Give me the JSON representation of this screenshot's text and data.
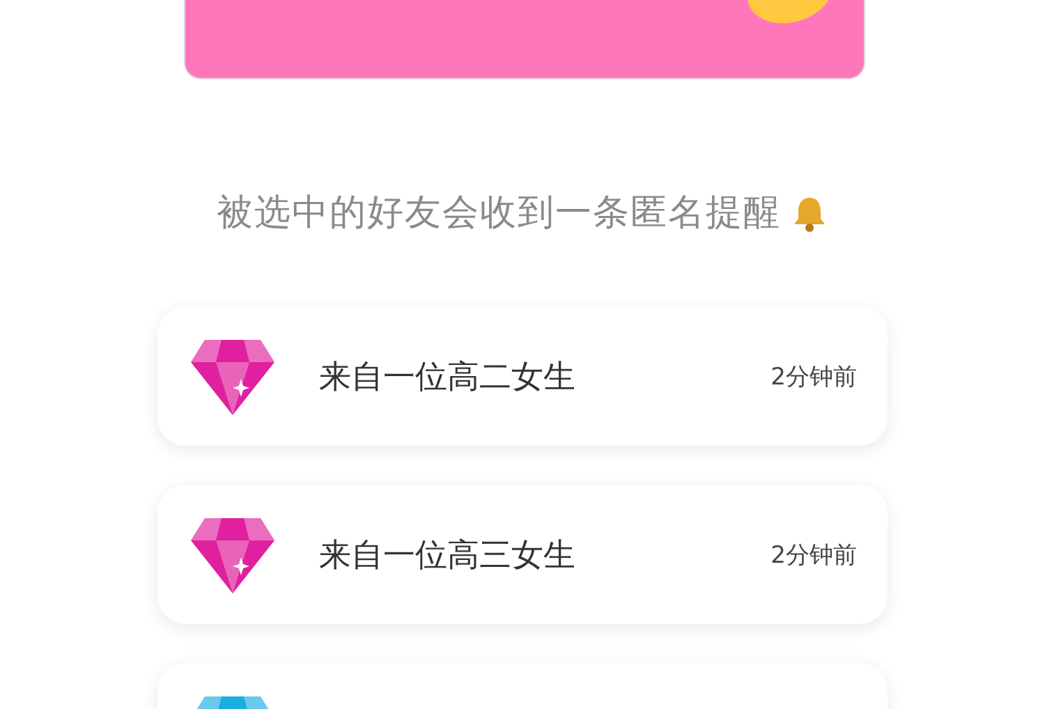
{
  "banner": {
    "color": "#ff77bb"
  },
  "caption": "被选中的好友会收到一条匿名提醒",
  "messages": [
    {
      "color": "#e0209e",
      "title": "来自一位高二女生",
      "time": "2分钟前"
    },
    {
      "color": "#e0209e",
      "title": "来自一位高三女生",
      "time": "2分钟前"
    },
    {
      "color": "#1aaee0"
    }
  ]
}
